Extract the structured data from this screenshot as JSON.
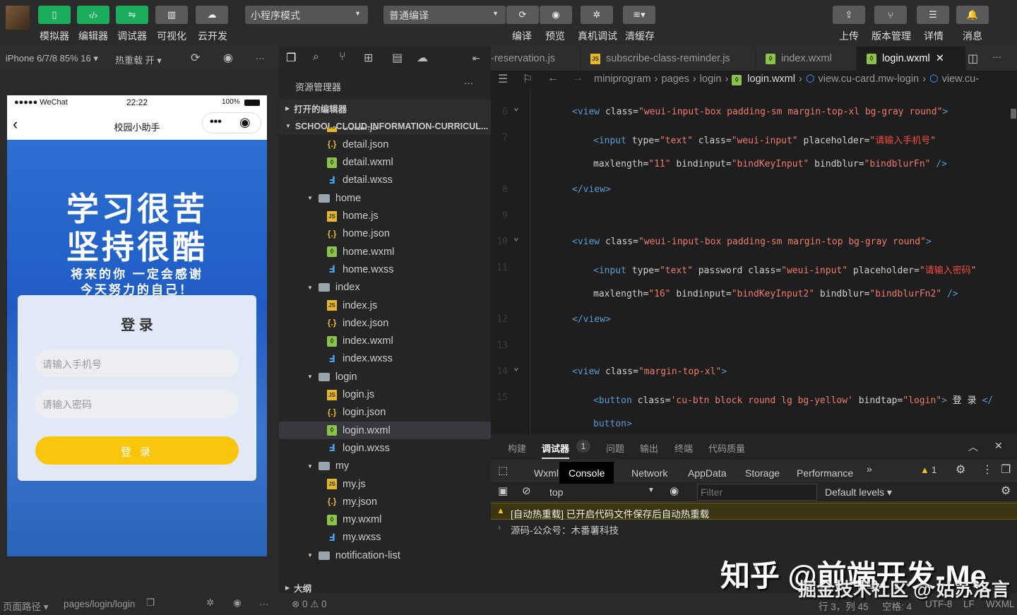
{
  "toolbar": {
    "left": [
      {
        "label": "模拟器",
        "icon": "phone-icon"
      },
      {
        "label": "编辑器",
        "icon": "code-icon"
      },
      {
        "label": "调试器",
        "icon": "sliders-icon"
      },
      {
        "label": "可视化",
        "icon": "layout-icon"
      },
      {
        "label": "云开发",
        "icon": "cloud-icon"
      }
    ],
    "mode": "小程序模式",
    "compile_mode": "普通编译",
    "middle": [
      {
        "label": "编译",
        "icon": "refresh-icon"
      },
      {
        "label": "预览",
        "icon": "eye-icon"
      },
      {
        "label": "真机调试",
        "icon": "bug-icon"
      },
      {
        "label": "清缓存",
        "icon": "layers-icon"
      }
    ],
    "right": [
      {
        "label": "上传",
        "icon": "upload-icon"
      },
      {
        "label": "版本管理",
        "icon": "branch-icon"
      },
      {
        "label": "详情",
        "icon": "menu-icon"
      },
      {
        "label": "消息",
        "icon": "bell-icon"
      }
    ]
  },
  "simulator": {
    "device": "iPhone 6/7/8 85% 16 ▾",
    "hot_reload": "热重载 开 ▾",
    "phone": {
      "carrier": "●●●●● WeChat",
      "time": "22:22",
      "battery": "100%",
      "title": "校园小助手",
      "hero_line1": "学习很苦",
      "hero_line2": "坚持很酷",
      "hero_sub1": "将来的你 一定会感谢",
      "hero_sub2": "今天努力的自己！",
      "card_title": "登 录",
      "phone_placeholder": "请输入手机号",
      "password_placeholder": "请输入密码",
      "login_button": "登 录"
    }
  },
  "explorer": {
    "title": "资源管理器",
    "open_editors": "打开的编辑器",
    "project": "SCHOOL-CLOUD-INFORMATION-CURRICUL...",
    "items": [
      {
        "name": "detail.js",
        "type": "js",
        "depth": 2
      },
      {
        "name": "detail.json",
        "type": "json",
        "depth": 2
      },
      {
        "name": "detail.wxml",
        "type": "wxml",
        "depth": 2
      },
      {
        "name": "detail.wxss",
        "type": "wxss",
        "depth": 2
      },
      {
        "name": "home",
        "type": "folder",
        "depth": 1
      },
      {
        "name": "home.js",
        "type": "js",
        "depth": 2
      },
      {
        "name": "home.json",
        "type": "json",
        "depth": 2
      },
      {
        "name": "home.wxml",
        "type": "wxml",
        "depth": 2
      },
      {
        "name": "home.wxss",
        "type": "wxss",
        "depth": 2
      },
      {
        "name": "index",
        "type": "folder",
        "depth": 1
      },
      {
        "name": "index.js",
        "type": "js",
        "depth": 2
      },
      {
        "name": "index.json",
        "type": "json",
        "depth": 2
      },
      {
        "name": "index.wxml",
        "type": "wxml",
        "depth": 2
      },
      {
        "name": "index.wxss",
        "type": "wxss",
        "depth": 2
      },
      {
        "name": "login",
        "type": "folder",
        "depth": 1
      },
      {
        "name": "login.js",
        "type": "js",
        "depth": 2
      },
      {
        "name": "login.json",
        "type": "json",
        "depth": 2
      },
      {
        "name": "login.wxml",
        "type": "wxml",
        "depth": 2,
        "selected": true
      },
      {
        "name": "login.wxss",
        "type": "wxss",
        "depth": 2
      },
      {
        "name": "my",
        "type": "folder",
        "depth": 1
      },
      {
        "name": "my.js",
        "type": "js",
        "depth": 2
      },
      {
        "name": "my.json",
        "type": "json",
        "depth": 2
      },
      {
        "name": "my.wxml",
        "type": "wxml",
        "depth": 2
      },
      {
        "name": "my.wxss",
        "type": "wxss",
        "depth": 2
      },
      {
        "name": "notification-list",
        "type": "folder",
        "depth": 1
      }
    ],
    "outline": "大纲",
    "problems": "⊗ 0 ⚠ 0"
  },
  "editor": {
    "tabs": [
      {
        "name": "-reservation.js"
      },
      {
        "name": "subscribe-class-reminder.js",
        "type": "js"
      },
      {
        "name": "index.wxml",
        "type": "wxml"
      },
      {
        "name": "login.wxml",
        "type": "wxml",
        "active": true
      }
    ],
    "breadcrumb": [
      "miniprogram",
      "pages",
      "login",
      "login.wxml",
      "view.cu-card.mw-login",
      "view.cu-"
    ],
    "lines": [
      {
        "num": "6",
        "indent": 1,
        "fold": true,
        "tokens": [
          [
            "tag",
            "<view "
          ],
          [
            "attr",
            "class="
          ],
          [
            "str",
            "\"weui-input-box padding-sm margin-top-xl bg-gray round\""
          ],
          [
            "tag",
            ">"
          ]
        ]
      },
      {
        "num": "7",
        "indent": 2,
        "tokens": [
          [
            "tag",
            "<input "
          ],
          [
            "attr",
            "type="
          ],
          [
            "str",
            "\"text\""
          ],
          [
            "attr",
            " class="
          ],
          [
            "str",
            "\"weui-input\""
          ],
          [
            "attr",
            " placeholder="
          ],
          [
            "str",
            "\""
          ],
          [
            "cn",
            "请输入手机号"
          ],
          [
            "str",
            "\""
          ]
        ]
      },
      {
        "num": "",
        "indent": 2,
        "tokens": [
          [
            "attr",
            "maxlength="
          ],
          [
            "str",
            "\"11\""
          ],
          [
            "attr",
            " bindinput="
          ],
          [
            "str",
            "\"bindKeyInput\""
          ],
          [
            "attr",
            " bindblur="
          ],
          [
            "str",
            "\"bindblurFn\""
          ],
          [
            "tag",
            " />"
          ]
        ]
      },
      {
        "num": "8",
        "indent": 1,
        "tokens": [
          [
            "tag",
            "</view>"
          ]
        ]
      },
      {
        "num": "9",
        "indent": 1,
        "tokens": []
      },
      {
        "num": "10",
        "indent": 1,
        "fold": true,
        "tokens": [
          [
            "tag",
            "<view "
          ],
          [
            "attr",
            "class="
          ],
          [
            "str",
            "\"weui-input-box padding-sm margin-top bg-gray round\""
          ],
          [
            "tag",
            ">"
          ]
        ]
      },
      {
        "num": "11",
        "indent": 2,
        "tokens": [
          [
            "tag",
            "<input "
          ],
          [
            "attr",
            "type="
          ],
          [
            "str",
            "\"text\""
          ],
          [
            "attr",
            " password class="
          ],
          [
            "str",
            "\"weui-input\""
          ],
          [
            "attr",
            " placeholder="
          ],
          [
            "str",
            "\""
          ],
          [
            "cn",
            "请输入密码"
          ],
          [
            "str",
            "\""
          ]
        ]
      },
      {
        "num": "",
        "indent": 2,
        "tokens": [
          [
            "attr",
            "maxlength="
          ],
          [
            "str",
            "\"16\""
          ],
          [
            "attr",
            " bindinput="
          ],
          [
            "str",
            "\"bindKeyInput2\""
          ],
          [
            "attr",
            " bindblur="
          ],
          [
            "str",
            "\"bindblurFn2\""
          ],
          [
            "tag",
            " />"
          ]
        ]
      },
      {
        "num": "12",
        "indent": 1,
        "tokens": [
          [
            "tag",
            "</view>"
          ]
        ]
      },
      {
        "num": "13",
        "indent": 1,
        "tokens": []
      },
      {
        "num": "14",
        "indent": 1,
        "fold": true,
        "tokens": [
          [
            "tag",
            "<view "
          ],
          [
            "attr",
            "class="
          ],
          [
            "str",
            "\"margin-top-xl\""
          ],
          [
            "tag",
            ">"
          ]
        ]
      },
      {
        "num": "15",
        "indent": 2,
        "tokens": [
          [
            "tag",
            "<button "
          ],
          [
            "attr",
            "class="
          ],
          [
            "str",
            "'cu-btn block round lg bg-yellow'"
          ],
          [
            "attr",
            " bindtap="
          ],
          [
            "str",
            "\"login\""
          ],
          [
            "tag",
            ">"
          ],
          [
            "txt",
            " 登 录 "
          ],
          [
            "tag",
            "</"
          ]
        ]
      },
      {
        "num": "",
        "indent": 2,
        "tokens": [
          [
            "tag",
            "button>"
          ]
        ]
      }
    ]
  },
  "debug": {
    "panel_tabs": [
      "构建",
      "调试器",
      "问题",
      "输出",
      "终端",
      "代码质量"
    ],
    "debugger_badge": "1",
    "devtools_tabs": [
      "Wxml",
      "Console",
      "Network",
      "AppData",
      "Storage",
      "Performance"
    ],
    "active_tab": "Console",
    "warn_count": "1",
    "context": "top",
    "filter_placeholder": "Filter",
    "levels": "Default levels ▾",
    "messages": [
      {
        "level": "warning",
        "text": "[自动热重载] 已开启代码文件保存后自动热重载"
      },
      {
        "level": "log",
        "text": "源码-公众号：木番薯科技"
      }
    ]
  },
  "statusbar": {
    "page_path_label": "页面路径 ▾",
    "page_path": "pages/login/login",
    "cursor": "行 3，列 45",
    "spaces": "空格: 4",
    "encoding": "UTF-8",
    "eol": "LF",
    "language": "WXML"
  },
  "watermarks": [
    "知乎 @前端开发-Me",
    "掘金技术社区 @ 姑苏洛言"
  ]
}
